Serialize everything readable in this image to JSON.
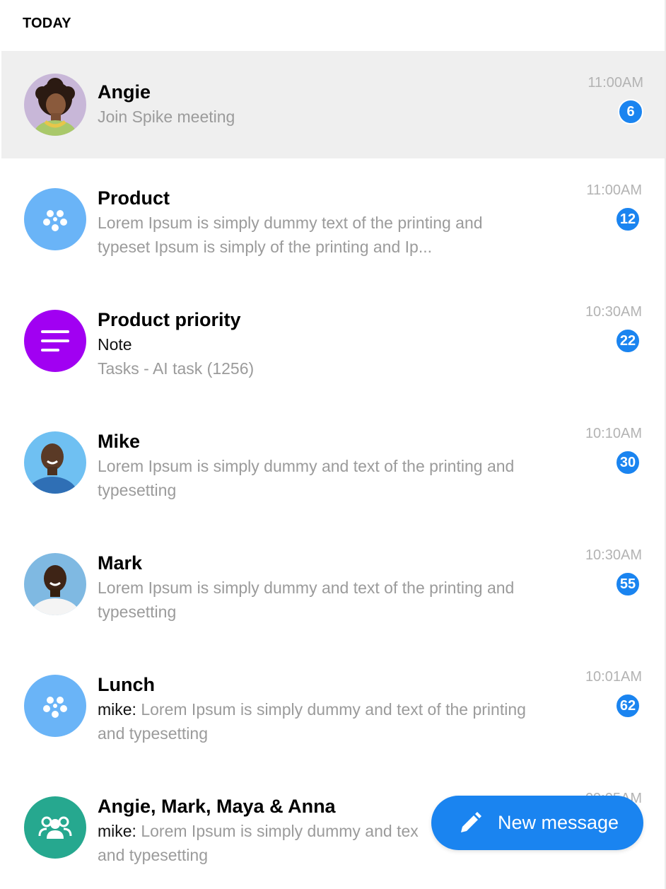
{
  "section": {
    "title": "TODAY"
  },
  "colors": {
    "accent": "#1a84f0",
    "selected_row": "#efefef",
    "product_avatar": "#6ab4f7",
    "priority_avatar": "#a100f2",
    "group_avatar": "#26a88f"
  },
  "conversations": [
    {
      "name": "Angie",
      "line1": "Join Spike meeting",
      "line2": "",
      "time": "11:00AM",
      "badge": "6",
      "avatar": "photo-angie"
    },
    {
      "name": "Product",
      "line1": "Lorem Ipsum is simply dummy text of the printing and",
      "line2": "typeset Ipsum is simply of the printing and  Ip...",
      "time": "11:00AM",
      "badge": "12",
      "avatar": "dots-icon"
    },
    {
      "name": "Product priority",
      "line1": "Note",
      "line2": "Tasks - AI task (1256)",
      "time": "10:30AM",
      "badge": "22",
      "avatar": "note-lines-icon"
    },
    {
      "name": "Mike",
      "line1": "Lorem Ipsum is simply dummy and text of the printing and",
      "line2": "typesetting",
      "time": "10:10AM",
      "badge": "30",
      "avatar": "photo-mike"
    },
    {
      "name": "Mark",
      "line1": "Lorem Ipsum is simply dummy and text of the printing and",
      "line2": "typesetting",
      "time": "10:30AM",
      "badge": "55",
      "avatar": "photo-mark"
    },
    {
      "name": "Lunch",
      "sender": "mike:",
      "line1": " Lorem Ipsum is simply dummy and text of the printing",
      "line2": "and typesetting",
      "time": "10:01AM",
      "badge": "62",
      "avatar": "dots-icon"
    },
    {
      "name": "Angie, Mark, Maya & Anna",
      "sender": "mike:",
      "line1": " Lorem Ipsum is simply dummy and tex",
      "line2": "and typesetting",
      "time": "09:05AM",
      "avatar": "group-icon"
    }
  ],
  "fab": {
    "label": "New message",
    "icon": "pencil-icon"
  }
}
